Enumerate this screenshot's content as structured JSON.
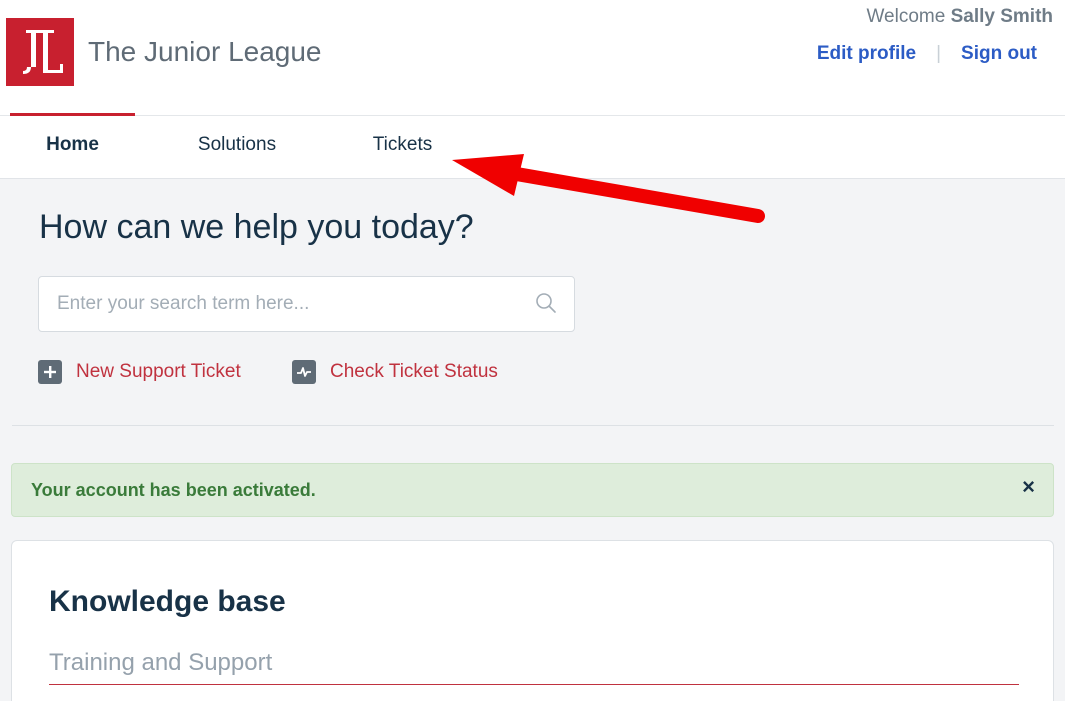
{
  "header": {
    "portal_name": "The Junior League",
    "welcome_prefix": "Welcome",
    "user_name": "Sally Smith",
    "edit_profile": "Edit profile",
    "separator": "|",
    "sign_out": "Sign out"
  },
  "nav": {
    "tabs": [
      {
        "label": "Home",
        "active": true
      },
      {
        "label": "Solutions",
        "active": false
      },
      {
        "label": "Tickets",
        "active": false
      }
    ]
  },
  "hero": {
    "title": "How can we help you today?",
    "search_placeholder": "Enter your search term here...",
    "actions": [
      {
        "label": "New Support Ticket",
        "icon": "plus-square-icon"
      },
      {
        "label": "Check Ticket Status",
        "icon": "pulse-icon"
      }
    ]
  },
  "alert": {
    "message": "Your account has been activated.",
    "close": "×"
  },
  "knowledge_base": {
    "title": "Knowledge base",
    "category": "Training and Support"
  },
  "colors": {
    "brand_red": "#c8202f",
    "link_blue": "#2c5cc5",
    "success_bg": "#deeddb",
    "annotation_arrow": "#f00000"
  }
}
